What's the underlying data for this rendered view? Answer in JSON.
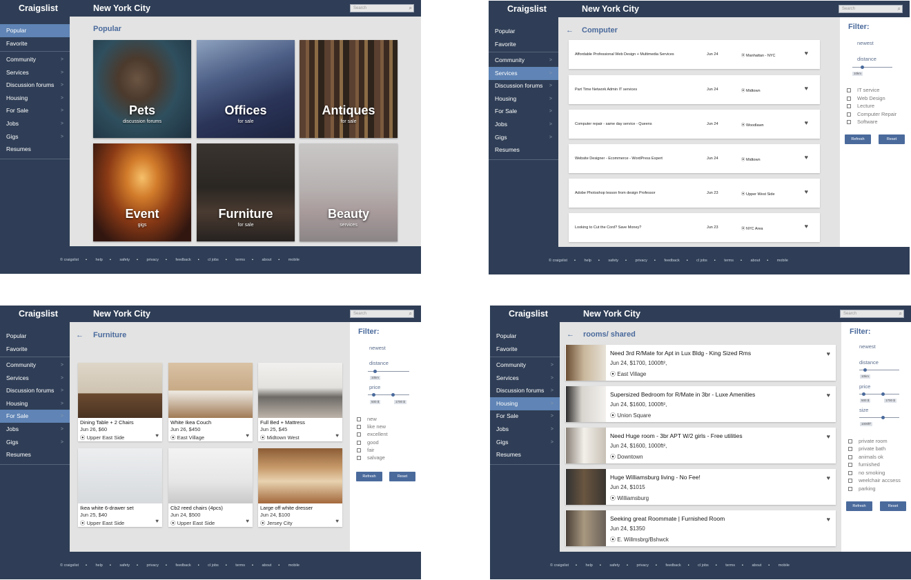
{
  "brand": "Craigslist",
  "city": "New York City",
  "search_placeholder": "Search",
  "nav": {
    "popular": "Popular",
    "favorite": "Favorite",
    "community": "Community",
    "services": "Services",
    "discussion": "Discussion forums",
    "housing": "Housing",
    "forsale": "For Sale",
    "jobs": "Jobs",
    "gigs": "Gigs",
    "resumes": "Resumes"
  },
  "footer": {
    "copyright": "© craigslist",
    "links": [
      "help",
      "safety",
      "privacy",
      "feedback",
      "cl jobs",
      "terms",
      "about",
      "mobile"
    ]
  },
  "screen1": {
    "title": "Popular",
    "tiles": [
      {
        "name": "Pets",
        "sub": "discussion forums"
      },
      {
        "name": "Offices",
        "sub": "for sale"
      },
      {
        "name": "Antiques",
        "sub": "for sale"
      },
      {
        "name": "Event",
        "sub": "gigs"
      },
      {
        "name": "Furniture",
        "sub": "for sale"
      },
      {
        "name": "Beauty",
        "sub": "services"
      }
    ]
  },
  "screen2": {
    "title": "Computer",
    "rows": [
      {
        "title": "Affordable Professional Web Design + Multimedia Services",
        "date": "Jun 24",
        "loc": "Manhattan - NYC"
      },
      {
        "title": "Part Time Network Admin IT services",
        "date": "Jun 24",
        "loc": "Midtown"
      },
      {
        "title": "Computer repair - same day service - Queens",
        "date": "Jun 24",
        "loc": "Woodlawn"
      },
      {
        "title": "Website Designer - Ecommerce - WordPress Expert",
        "date": "Jun 24",
        "loc": "Midtown"
      },
      {
        "title": "Adobe Photoshop lesson from design Professor",
        "date": "Jun 23",
        "loc": "Upper West Side"
      },
      {
        "title": "Looking to Cut the Cord? Save Money?",
        "date": "Jun 23",
        "loc": "NYC Area"
      }
    ],
    "filter": {
      "title": "Filter:",
      "newest": "newest",
      "distance": "distance",
      "distance_value": "10km",
      "checkboxes": [
        "IT service",
        "Web Design",
        "Lecture",
        "Computer Repair",
        "Software"
      ],
      "refresh": "Refresh",
      "reset": "Reset"
    }
  },
  "screen3": {
    "title": "Furniture",
    "cards": [
      {
        "title": "Dining Table + 2 Chairs",
        "price": "Jun 26, $60",
        "loc": "Upper East Side"
      },
      {
        "title": "White Ikea Couch",
        "price": "Jun 26, $450",
        "loc": "East Village"
      },
      {
        "title": "Full Bed + Mattress",
        "price": "Jun 25, $45",
        "loc": "Midtown West"
      },
      {
        "title": "Ikea white 6-drawer set",
        "price": "Jun 25, $40",
        "loc": "Upper East Side"
      },
      {
        "title": "Cb2 reed chairs (4pcs)",
        "price": "Jun 24, $500",
        "loc": "Upper East Side"
      },
      {
        "title": "Large off white dresser",
        "price": "Jun 24, $100",
        "loc": "Jersey City"
      }
    ],
    "filter": {
      "title": "Filter:",
      "newest": "newest",
      "distance": "distance",
      "distance_value": "10km",
      "price": "price",
      "price_min": "500 $",
      "price_max": "1700 $",
      "checkboxes": [
        "new",
        "like new",
        "excellent",
        "good",
        "fair",
        "salvage"
      ],
      "refresh": "Refresh",
      "reset": "Reset"
    }
  },
  "screen4": {
    "title": "rooms/ shared",
    "cards": [
      {
        "title": "Need 3rd R/Mate for Apt in Lux Bldg - King Sized Rms",
        "price": "Jun 24, $1700, 1000ft²,",
        "loc": "East Village"
      },
      {
        "title": "Supersized Bedroom for R/Mate in 3br - Luxe Amenities",
        "price": "Jun 24, $1600, 1000ft²,",
        "loc": "Union Square"
      },
      {
        "title": "Need Huge room - 3br APT W/2 girls - Free utilities",
        "price": "Jun 24, $1600, 1000ft²,",
        "loc": "Downtown"
      },
      {
        "title": "Huge Williamsburg living - No Fee!",
        "price": "Jun 24, $1015",
        "loc": "Williamsburg"
      },
      {
        "title": "Seeking great Roommate | Furnished Room",
        "price": "Jun 24, $1350",
        "loc": "E. Willmsbrg/Bshwck"
      }
    ],
    "filter": {
      "title": "Filter:",
      "newest": "newest",
      "distance": "distance",
      "distance_value": "10km",
      "price": "price",
      "price_min": "500 $",
      "price_max": "1700 $",
      "size": "size",
      "size_value": "1000ft²",
      "checkboxes": [
        "private room",
        "private bath",
        "animals ok",
        "furnished",
        "no smoking",
        "weelchair accsess",
        "parking"
      ],
      "refresh": "Refresh",
      "reset": "Reset"
    }
  }
}
